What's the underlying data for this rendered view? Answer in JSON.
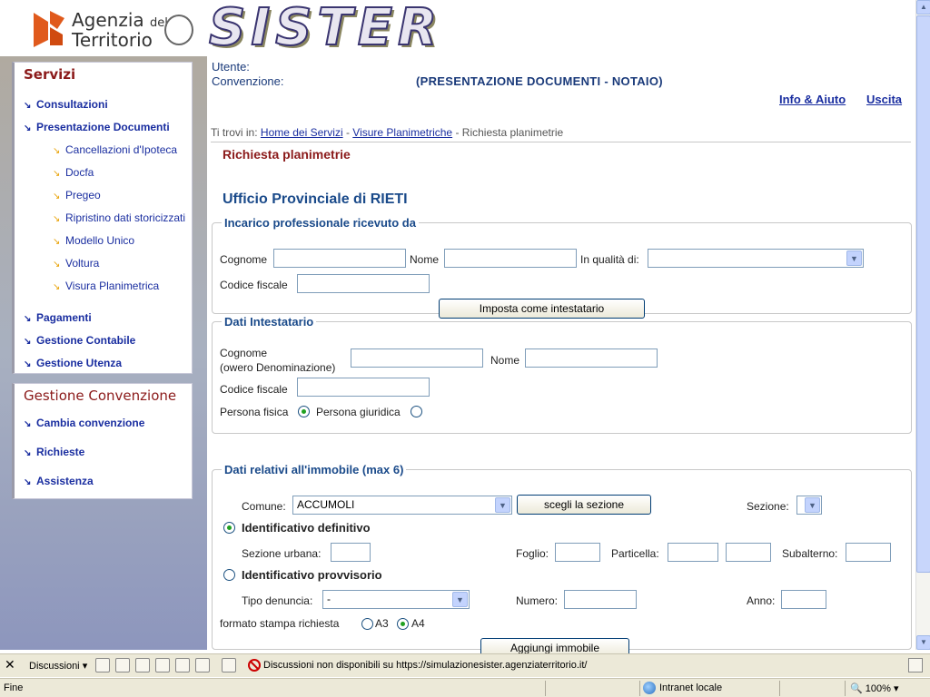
{
  "header": {
    "org_name_line1": "Agenzia",
    "org_name_del": "del",
    "org_name_line2": "Territorio",
    "brand": "SISTER"
  },
  "sidebar": {
    "servizi_title": "Servizi",
    "items": [
      {
        "label": "Consultazioni"
      },
      {
        "label": "Presentazione Documenti"
      }
    ],
    "sub_items": [
      {
        "label": "Cancellazioni d'Ipoteca"
      },
      {
        "label": "Docfa"
      },
      {
        "label": "Pregeo"
      },
      {
        "label": "Ripristino dati storicizzati"
      },
      {
        "label": "Modello Unico"
      },
      {
        "label": "Voltura"
      },
      {
        "label": "Visura Planimetrica"
      }
    ],
    "items2": [
      {
        "label": "Pagamenti"
      },
      {
        "label": "Gestione Contabile"
      },
      {
        "label": "Gestione Utenza"
      }
    ],
    "convenzione_title": "Gestione Convenzione",
    "conv_items": [
      {
        "label": "Cambia convenzione"
      },
      {
        "label": "Richieste"
      },
      {
        "label": "Assistenza"
      }
    ]
  },
  "main": {
    "utente_label": "Utente:",
    "convenzione_label": "Convenzione:",
    "convenzione_value": "(PRESENTAZIONE DOCUMENTI - NOTAIO)",
    "info_link": "Info & Aiuto",
    "uscita_link": "Uscita",
    "breadcrumb": {
      "prefix": "Ti trovi in:",
      "home": "Home dei Servizi",
      "sep": " - ",
      "visure": "Visure Planimetriche",
      "current": "Richiesta planimetrie"
    },
    "page_title": "Richiesta planimetrie",
    "ufficio": "Ufficio Provinciale di RIETI"
  },
  "incarico": {
    "legend": "Incarico professionale ricevuto da",
    "cognome_label": "Cognome",
    "nome_label": "Nome",
    "qualita_label": "In qualità di:",
    "codice_fiscale_label": "Codice fiscale",
    "button": "Imposta come intestatario"
  },
  "intestatario": {
    "legend": "Dati Intestatario",
    "cognome_label_1": "Cognome",
    "cognome_label_2": "(owero Denominazione)",
    "nome_label": "Nome",
    "codice_fiscale_label": "Codice fiscale",
    "persona_fisica": "Persona fisica",
    "persona_giuridica": "Persona giuridica"
  },
  "immobile": {
    "legend": "Dati relativi all'immobile (max 6)",
    "comune_label": "Comune:",
    "comune_value": "ACCUMOLI",
    "sceglie_button": "scegli la sezione",
    "sezione_label": "Sezione:",
    "id_definitivo": "Identificativo definitivo",
    "sezione_urbana_label": "Sezione urbana:",
    "foglio_label": "Foglio:",
    "particella_label": "Particella:",
    "subalterno_label": "Subalterno:",
    "id_provvisorio": "Identificativo provvisorio",
    "tipo_denuncia_label": "Tipo denuncia:",
    "tipo_denuncia_value": "-",
    "numero_label": "Numero:",
    "anno_label": "Anno:",
    "formato_label": "formato stampa richiesta",
    "a3": "A3",
    "a4": "A4",
    "aggiungi_button": "Aggiungi immobile"
  },
  "discussion_bar": {
    "label": "Discussioni",
    "message": "Discussioni non disponibili su https://simulazionesister.agenziaterritorio.it/"
  },
  "status_bar": {
    "status": "Fine",
    "zone": "Intranet locale",
    "zoom": "100%"
  },
  "colors": {
    "menu_link": "#1a2ea0",
    "title_red": "#8b1a1a",
    "heading_blue": "#1a4a8a"
  }
}
